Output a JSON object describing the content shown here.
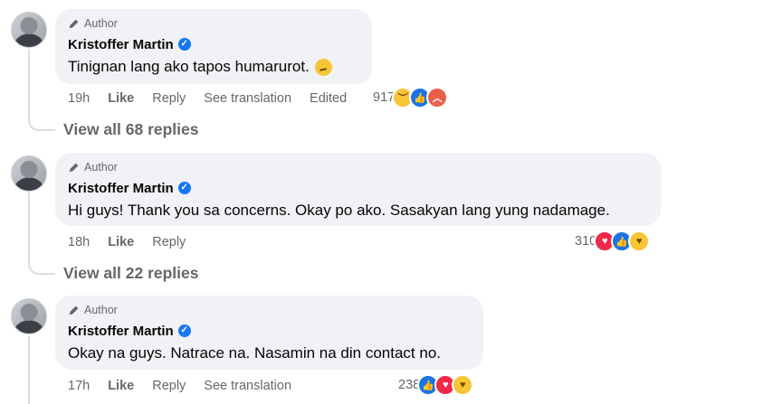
{
  "comments": [
    {
      "author_badge": "Author",
      "name": "Kristoffer Martin",
      "text": "Tinignan lang ako tapos humarurot.",
      "emoji": "thinking-face-icon",
      "time": "19h",
      "like": "Like",
      "reply": "Reply",
      "translate": "See translation",
      "edited": "Edited",
      "reaction_count": "917",
      "reactions": [
        "sad",
        "like",
        "angry"
      ],
      "view_replies": "View all 68 replies"
    },
    {
      "author_badge": "Author",
      "name": "Kristoffer Martin",
      "text": "Hi guys! Thank you sa concerns. Okay po ako. Sasakyan lang yung nadamage.",
      "time": "18h",
      "like": "Like",
      "reply": "Reply",
      "reaction_count": "310",
      "reactions": [
        "love",
        "like",
        "care"
      ],
      "view_replies": "View all 22 replies"
    },
    {
      "author_badge": "Author",
      "name": "Kristoffer Martin",
      "text": "Okay na guys. Natrace na. Nasamin na din contact no.",
      "time": "17h",
      "like": "Like",
      "reply": "Reply",
      "translate": "See translation",
      "reaction_count": "238",
      "reactions": [
        "like",
        "love",
        "care"
      ]
    }
  ],
  "colors": {
    "verified": "#1877f2",
    "bubble": "#f0f2f5",
    "muted_text": "#65676b"
  }
}
